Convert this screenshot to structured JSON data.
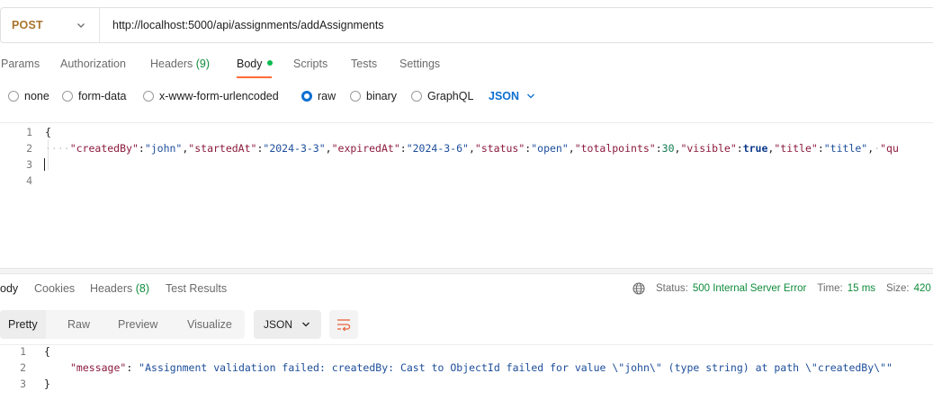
{
  "request": {
    "method": "POST",
    "url": "http://localhost:5000/api/assignments/addAssignments"
  },
  "request_tabs": [
    {
      "label": "Params"
    },
    {
      "label": "Authorization"
    },
    {
      "label": "Headers",
      "count": "(9)"
    },
    {
      "label": "Body",
      "active": true
    },
    {
      "label": "Scripts"
    },
    {
      "label": "Tests"
    },
    {
      "label": "Settings"
    }
  ],
  "body_types": {
    "none": "none",
    "form_data": "form-data",
    "urlencoded": "x-www-form-urlencoded",
    "raw": "raw",
    "binary": "binary",
    "graphql": "GraphQL",
    "selected": "raw",
    "language": "JSON"
  },
  "editor": {
    "line_numbers": [
      "1",
      "2",
      "3",
      "4"
    ],
    "line1": "{",
    "line2": {
      "k1": "\"createdBy\"",
      "v1": "\"john\"",
      "k2": "\"startedAt\"",
      "v2": "\"2024-3-3\"",
      "k3": "\"expiredAt\"",
      "v3": "\"2024-3-6\"",
      "k4": "\"status\"",
      "v4": "\"open\"",
      "k5": "\"totalpoints\"",
      "v5": "30",
      "k6": "\"visible\"",
      "v6": "true",
      "k7": "\"title\"",
      "v7": "\"title\"",
      "k8": "\"qu"
    }
  },
  "response_tabs": {
    "body": "ody",
    "cookies": "Cookies",
    "headers": "Headers",
    "headers_count": "(8)",
    "test_results": "Test Results"
  },
  "response_status": {
    "status_label": "Status:",
    "status_value": "500 Internal Server Error",
    "time_label": "Time:",
    "time_value": "15 ms",
    "size_label": "Size:",
    "size_value": "420"
  },
  "view_tabs": {
    "pretty": "Pretty",
    "raw": "Raw",
    "preview": "Preview",
    "visualize": "Visualize",
    "format": "JSON"
  },
  "response_body": {
    "line_numbers": [
      "1",
      "2",
      "3"
    ],
    "open": "{",
    "key": "\"message\"",
    "value": "\"Assignment validation failed: createdBy: Cast to ObjectId failed for value \\\"john\\\" (type string) at path \\\"createdBy\\\"\"",
    "close": "}"
  },
  "colors": {
    "accent": "#ff6c37",
    "method": "#a9742c",
    "link": "#0d6fd1",
    "success": "#0f8c3b"
  }
}
